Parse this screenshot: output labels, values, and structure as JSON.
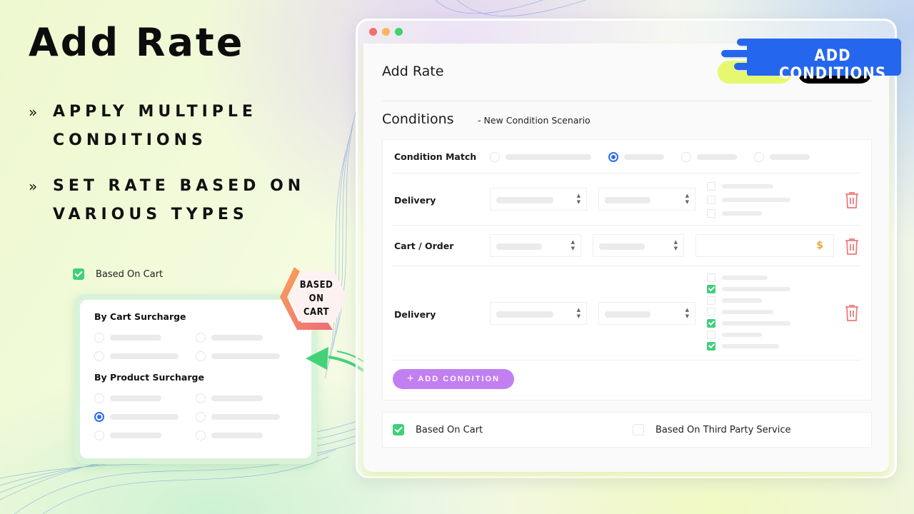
{
  "hero": {
    "title": "Add Rate",
    "bullets": [
      {
        "icon": "double-chevron-right-icon",
        "text": "APPLY MULTIPLE\nCONDITIONS"
      },
      {
        "icon": "double-chevron-right-icon",
        "text": "SET RATE BASED ON\nVARIOUS TYPES"
      }
    ]
  },
  "mini": {
    "checkbox_label": "Based On Cart",
    "checkbox_checked": true,
    "badge": "BASED\nON\nCART",
    "sections": [
      {
        "heading": "By Cart Surcharge",
        "selected_index": -1
      },
      {
        "heading": "By Product Surcharge",
        "selected_index": 2
      }
    ]
  },
  "window": {
    "title": "Add Rate",
    "save_label": "",
    "back_label": "",
    "conditions_title": "Conditions",
    "conditions_subtitle": "-  New Condition Scenario",
    "condition_match": {
      "label": "Condition Match",
      "selected_index": 1
    },
    "rows": [
      {
        "label": "Delivery",
        "type": "checkbox-list",
        "checked": [
          false,
          false,
          false
        ]
      },
      {
        "label": "Cart / Order",
        "type": "money",
        "currency": "$"
      },
      {
        "label": "Delivery",
        "type": "checkbox-list",
        "checked": [
          false,
          true,
          false,
          false,
          true,
          false,
          true
        ]
      }
    ],
    "add_condition_label": "ADD CONDITION",
    "based_options": [
      {
        "label": "Based On Cart",
        "checked": true
      },
      {
        "label": "Based On Third Party Service",
        "checked": false
      }
    ]
  },
  "banner": {
    "text": "ADD CONDITIONS"
  },
  "colors": {
    "accent_blue": "#2467ee",
    "check_green": "#3fd07a",
    "add_purple": "#c17ff2",
    "save_yellow": "#e6f870",
    "trash_red": "#f07a7a",
    "currency_orange": "#f4a446"
  }
}
